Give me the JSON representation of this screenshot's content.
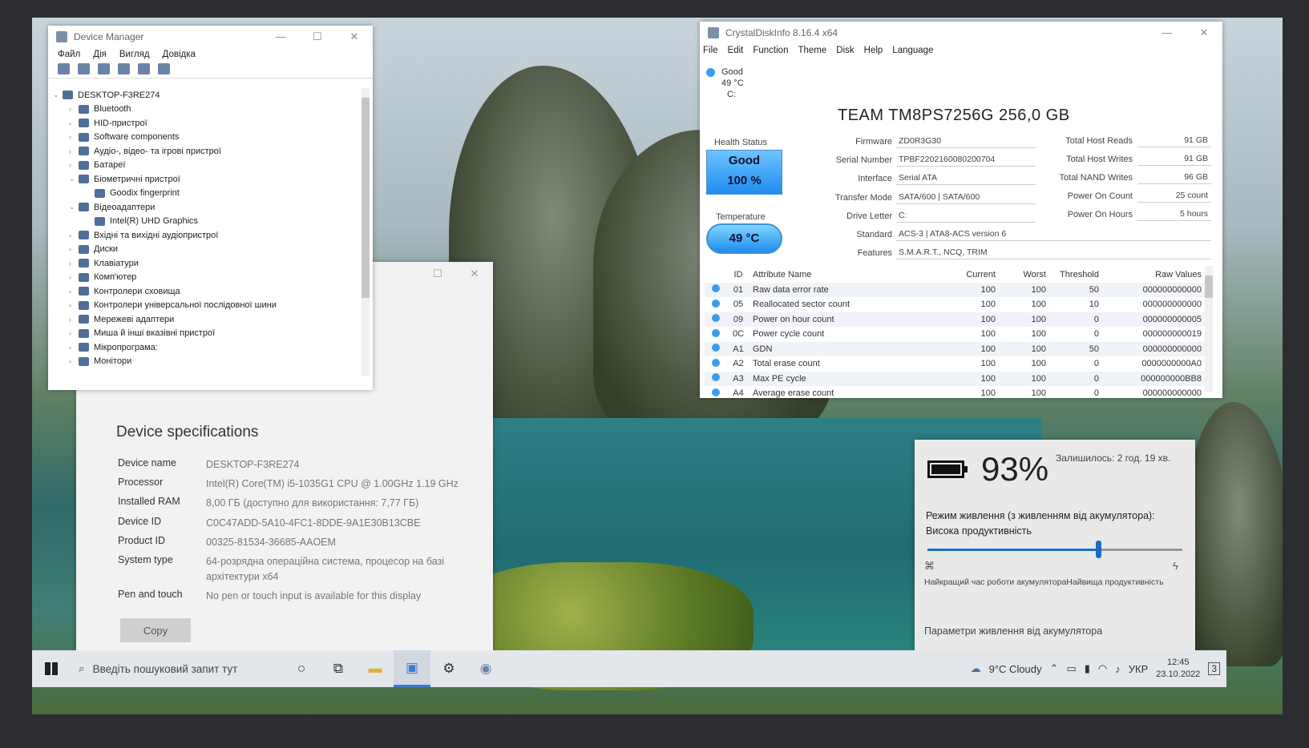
{
  "device_manager": {
    "title": "Device Manager",
    "menu": [
      "Файл",
      "Дія",
      "Вигляд",
      "Довідка"
    ],
    "tree": [
      {
        "label": "DESKTOP-F3RE274",
        "level": 0,
        "arrow": "⌄"
      },
      {
        "label": "Bluetooth",
        "level": 1,
        "arrow": "›"
      },
      {
        "label": "HID-пристрої",
        "level": 1,
        "arrow": "›"
      },
      {
        "label": "Software components",
        "level": 1,
        "arrow": "›"
      },
      {
        "label": "Аудіо-, відео- та ігрові пристрої",
        "level": 1,
        "arrow": "›"
      },
      {
        "label": "Батареї",
        "level": 1,
        "arrow": "›"
      },
      {
        "label": "Біометричні пристрої",
        "level": 1,
        "arrow": "⌄"
      },
      {
        "label": "Goodix fingerprint",
        "level": 2,
        "arrow": ""
      },
      {
        "label": "Відеоадаптери",
        "level": 1,
        "arrow": "⌄"
      },
      {
        "label": "Intel(R) UHD Graphics",
        "level": 2,
        "arrow": ""
      },
      {
        "label": "Вхідні та вихідні аудіопристрої",
        "level": 1,
        "arrow": "›"
      },
      {
        "label": "Диски",
        "level": 1,
        "arrow": "›"
      },
      {
        "label": "Клавіатури",
        "level": 1,
        "arrow": "›"
      },
      {
        "label": "Комп'ютер",
        "level": 1,
        "arrow": "›"
      },
      {
        "label": "Контролери сховища",
        "level": 1,
        "arrow": "›"
      },
      {
        "label": "Контролери універсальної послідовної шини",
        "level": 1,
        "arrow": "›"
      },
      {
        "label": "Мережеві адаптери",
        "level": 1,
        "arrow": "›"
      },
      {
        "label": "Миша й інші вказівні пристрої",
        "level": 1,
        "arrow": "›"
      },
      {
        "label": "Мікропрограма:",
        "level": 1,
        "arrow": "›"
      },
      {
        "label": "Монітори",
        "level": 1,
        "arrow": "›"
      }
    ]
  },
  "about": {
    "title": "Device specifications",
    "specs": [
      {
        "key": "Device name",
        "value": "DESKTOP-F3RE274"
      },
      {
        "key": "Processor",
        "value": "Intel(R) Core(TM) i5-1035G1 CPU @ 1.00GHz   1.19 GHz"
      },
      {
        "key": "Installed RAM",
        "value": "8,00 ГБ (доступно для використання: 7,77 ГБ)"
      },
      {
        "key": "Device ID",
        "value": "C0C47ADD-5A10-4FC1-8DDE-9A1E30B13CBE"
      },
      {
        "key": "Product ID",
        "value": "00325-81534-36685-AAOEM"
      },
      {
        "key": "System type",
        "value": "64-розрядна операційна система, процесор на базі архітектури x64"
      },
      {
        "key": "Pen and touch",
        "value": "No pen or touch input is available for this display"
      }
    ],
    "copy_label": "Copy"
  },
  "cdi": {
    "title": "CrystalDiskInfo 8.16.4 x64",
    "menu": [
      "File",
      "Edit",
      "Function",
      "Theme",
      "Disk",
      "Help",
      "Language"
    ],
    "drive_status": "Good",
    "drive_temp": "49 °C",
    "drive_letter": "C:",
    "model": "TEAM TM8PS7256G 256,0 GB",
    "health_label": "Health Status",
    "health_status": "Good",
    "health_pct": "100 %",
    "temp_label": "Temperature",
    "temp_value": "49 °C",
    "fields": {
      "firmware_label": "Firmware",
      "firmware": "ZD0R3G30",
      "serial_label": "Serial Number",
      "serial": "TPBF2202160080200704",
      "interface_label": "Interface",
      "interface": "Serial ATA",
      "transfer_label": "Transfer Mode",
      "transfer": "SATA/600 | SATA/600",
      "letter_label": "Drive Letter",
      "letter": "C:",
      "standard_label": "Standard",
      "standard": "ACS-3 | ATA8-ACS version 6",
      "features_label": "Features",
      "features": "S.M.A.R.T., NCQ, TRIM"
    },
    "stats": {
      "reads_label": "Total Host Reads",
      "reads": "91 GB",
      "writes_label": "Total Host Writes",
      "writes": "91 GB",
      "nand_label": "Total NAND Writes",
      "nand": "96 GB",
      "count_label": "Power On Count",
      "count": "25 count",
      "hours_label": "Power On Hours",
      "hours": "5 hours"
    },
    "columns": [
      "ID",
      "Attribute Name",
      "Current",
      "Worst",
      "Threshold",
      "Raw Values"
    ],
    "attributes": [
      {
        "id": "01",
        "name": "Raw data error rate",
        "current": "100",
        "worst": "100",
        "threshold": "50",
        "raw": "000000000000"
      },
      {
        "id": "05",
        "name": "Reallocated sector count",
        "current": "100",
        "worst": "100",
        "threshold": "10",
        "raw": "000000000000"
      },
      {
        "id": "09",
        "name": "Power on hour count",
        "current": "100",
        "worst": "100",
        "threshold": "0",
        "raw": "000000000005"
      },
      {
        "id": "0C",
        "name": "Power cycle count",
        "current": "100",
        "worst": "100",
        "threshold": "0",
        "raw": "000000000019"
      },
      {
        "id": "A1",
        "name": "GDN",
        "current": "100",
        "worst": "100",
        "threshold": "50",
        "raw": "000000000000"
      },
      {
        "id": "A2",
        "name": "Total erase count",
        "current": "100",
        "worst": "100",
        "threshold": "0",
        "raw": "0000000000A0"
      },
      {
        "id": "A3",
        "name": "Max PE cycle",
        "current": "100",
        "worst": "100",
        "threshold": "0",
        "raw": "000000000BB8"
      },
      {
        "id": "A4",
        "name": "Average erase count",
        "current": "100",
        "worst": "100",
        "threshold": "0",
        "raw": "000000000000"
      }
    ]
  },
  "battery": {
    "percent": "93%",
    "remaining": "Залишилось: 2 год. 19 хв.",
    "mode": "Режим живлення (з живленням від акумулятора): Висока продуктивність",
    "slider_level": 0.67,
    "left_label": "Найкращий час роботи акумулятора",
    "right_label": "Найвища продуктивність",
    "settings_link": "Параметри живлення від акумулятора"
  },
  "taskbar": {
    "search_placeholder": "Введіть пошуковий запит тут",
    "weather": "9°C  Cloudy",
    "language": "УКР",
    "time": "12:45",
    "date": "23.10.2022",
    "notification_count": "3"
  },
  "colors": {
    "accent": "#1a6cc4",
    "health_blue": "#3d9be9"
  }
}
